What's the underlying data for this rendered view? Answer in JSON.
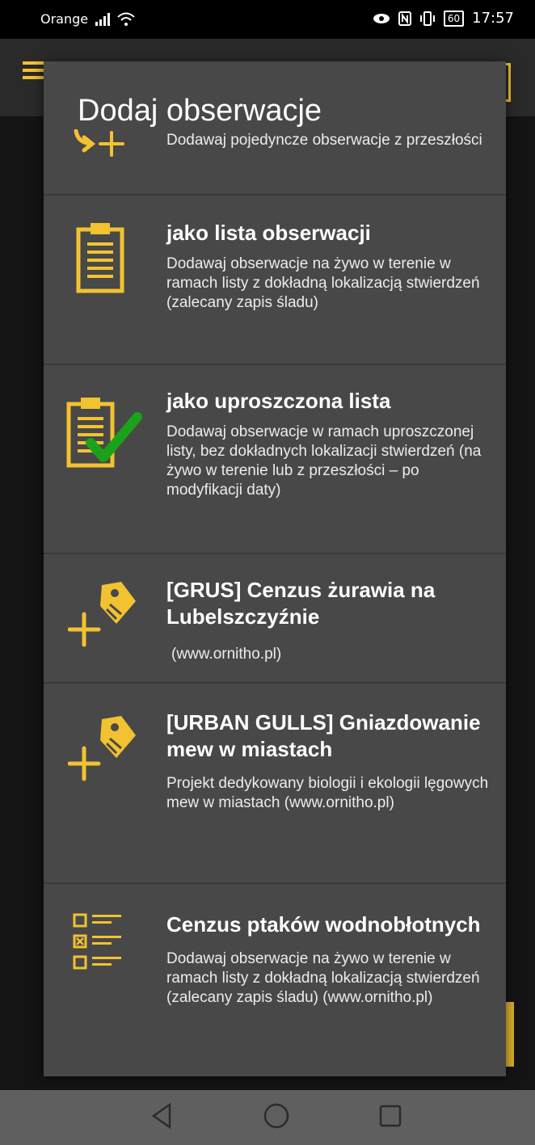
{
  "status_bar": {
    "carrier": "Orange",
    "battery": "60",
    "time": "17:57"
  },
  "dialog": {
    "title": "Dodaj obserwacje",
    "items": [
      {
        "icon": "phone-arrow-plus-icon",
        "title": "",
        "description": "Dodawaj pojedyncze obserwacje z przeszłości"
      },
      {
        "icon": "clipboard-list-icon",
        "title": "jako lista obserwacji",
        "description": "Dodawaj obserwacje na żywo w terenie w ramach listy z dokładną lokalizacją stwierdzeń (zalecany zapis śladu)"
      },
      {
        "icon": "clipboard-check-icon",
        "title": "jako uproszczona lista",
        "description": "Dodawaj obserwacje w ramach uproszczonej listy, bez dokładnych lokalizacji stwierdzeń (na żywo w terenie lub z przeszłości – po modyfikacji daty)"
      },
      {
        "icon": "tag-plus-icon",
        "title": "[GRUS] Cenzus żurawia na Lubelszczyźnie",
        "description": "(www.ornitho.pl)"
      },
      {
        "icon": "tag-plus-icon",
        "title": "[URBAN GULLS] Gniazdowanie mew w miastach",
        "description": "Projekt dedykowany biologii i ekologii lęgowych mew w miastach (www.ornitho.pl)"
      },
      {
        "icon": "checklist-icon",
        "title": "Cenzus ptaków wodnobłotnych",
        "description": "Dodawaj obserwacje na żywo w terenie w ramach listy z dokładną lokalizacją stwierdzeń (zalecany zapis śladu) (www.ornitho.pl)"
      }
    ]
  },
  "colors": {
    "accent": "#f2c230",
    "check": "#1aa31a",
    "dialog_bg": "#484848"
  }
}
